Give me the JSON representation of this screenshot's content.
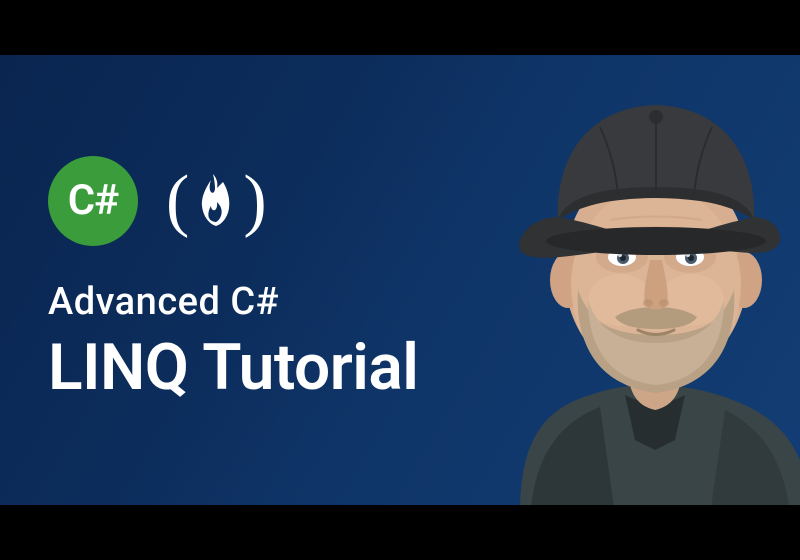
{
  "thumbnail": {
    "badge_text": "C#",
    "subtitle": "Advanced C#",
    "title": "LINQ Tutorial",
    "badge_color": "#3a9c3a",
    "bg_gradient_start": "#0a2550",
    "bg_gradient_end": "#123d74"
  },
  "logos": {
    "csharp_icon": "csharp-circle",
    "fcc_icon": "freecodecamp-flame"
  }
}
